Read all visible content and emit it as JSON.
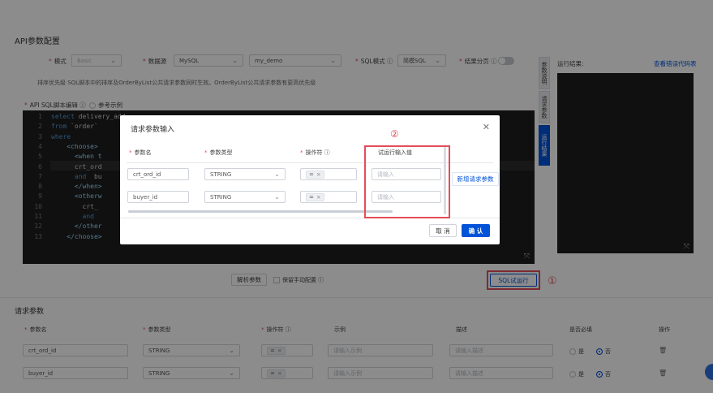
{
  "page": {
    "overlay_color": "#000000",
    "accent_color": "#0052d9",
    "highlight_color": "#e34d59"
  },
  "config": {
    "title": "API参数配置",
    "mode_label": "模式",
    "mode_value": "Basic",
    "datasource_label": "数据源",
    "datasource_type": "MySQL",
    "datasource_name": "my_demo",
    "sql_mode_label": "SQL模式",
    "sql_mode_value": "简模SQL",
    "paging_label": "结果分页",
    "sort_hint": "排序优先级   SQL脚本中的排序及OrderByList公共请求参数同时生效。OrderByList公共请求参数有更高优先级",
    "editor_label": "API SQL脚本编辑",
    "reference_label": "参考示例"
  },
  "code": [
    {
      "n": "1",
      "text": "select delivery_add"
    },
    {
      "n": "2",
      "text": "from `order`"
    },
    {
      "n": "3",
      "text": "where"
    },
    {
      "n": "4",
      "text": "    <choose>"
    },
    {
      "n": "5",
      "text": "      <when t"
    },
    {
      "n": "6",
      "text": "      crt_ord"
    },
    {
      "n": "7",
      "text": "      and  bu"
    },
    {
      "n": "8",
      "text": "      </when>"
    },
    {
      "n": "9",
      "text": "      <otherw"
    },
    {
      "n": "10",
      "text": "        crt_"
    },
    {
      "n": "11",
      "text": "        and"
    },
    {
      "n": "12",
      "text": "      </other"
    },
    {
      "n": "13",
      "text": "    </choose>"
    }
  ],
  "side_tabs": [
    "参数说明",
    "请求参数",
    "运行结果"
  ],
  "result": {
    "label": "运行结果:",
    "link": "查看错误代码表"
  },
  "editor_actions": {
    "parse": "解析参数",
    "keep_manual": "保留手动配置",
    "sql_test": "SQL试运行"
  },
  "annotations": {
    "one": "①",
    "two": "②"
  },
  "dialog": {
    "title": "请求参数输入",
    "col_name": "参数名",
    "col_type": "参数类型",
    "col_op": "操作符",
    "col_value": "试运行输入值",
    "rows": [
      {
        "name": "crt_ord_id",
        "type": "STRING",
        "op": "=",
        "placeholder": "请输入"
      },
      {
        "name": "buyer_id",
        "type": "STRING",
        "op": "=",
        "placeholder": "请输入"
      }
    ],
    "add_param": "新增请求参数",
    "cancel": "取 消",
    "confirm": "确 认"
  },
  "request_params": {
    "title": "请求参数",
    "headers": {
      "name": "参数名",
      "type": "参数类型",
      "op": "操作符",
      "example": "示例",
      "desc": "描述",
      "required": "是否必填",
      "action": "操作"
    },
    "rows": [
      {
        "name": "crt_ord_id",
        "type": "STRING",
        "op": "=",
        "example_ph": "请输入示例",
        "desc_ph": "请输入描述",
        "yes": "是",
        "no": "否"
      },
      {
        "name": "buyer_id",
        "type": "STRING",
        "op": "=",
        "example_ph": "请输入示例",
        "desc_ph": "请输入描述",
        "yes": "是",
        "no": "否"
      }
    ]
  }
}
